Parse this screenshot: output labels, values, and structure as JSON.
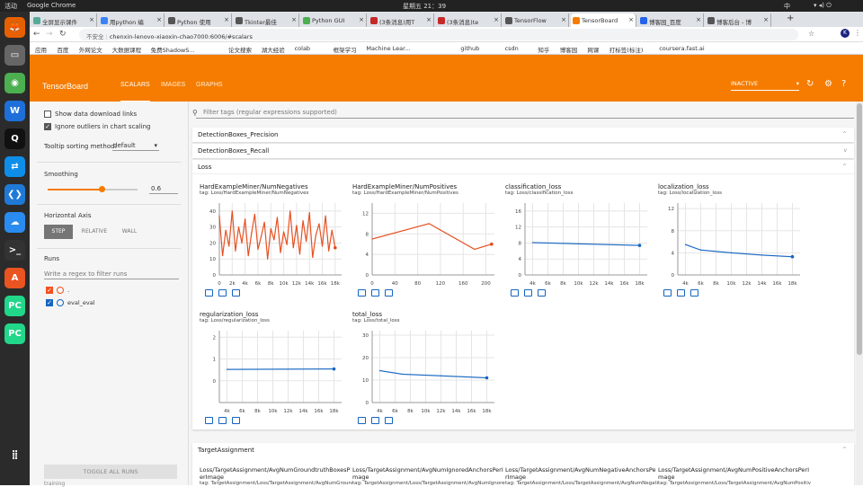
{
  "system": {
    "activities": "活动",
    "app_name": "Google Chrome",
    "clock": "星期五 21：39",
    "ime": "中"
  },
  "dock": [
    {
      "name": "firefox-icon",
      "color": "#e66000",
      "glyph": "🦊"
    },
    {
      "name": "files-icon",
      "color": "#666",
      "glyph": "▭"
    },
    {
      "name": "chrome-icon",
      "color": "#4caf50",
      "glyph": "◉"
    },
    {
      "name": "wps-icon",
      "color": "#1e6fd9",
      "glyph": "W"
    },
    {
      "name": "qq-icon",
      "color": "#111",
      "glyph": "Q"
    },
    {
      "name": "teamviewer-icon",
      "color": "#0e8ee9",
      "glyph": "⇄"
    },
    {
      "name": "vscode-icon",
      "color": "#1f7ad7",
      "glyph": "❮❯"
    },
    {
      "name": "baidu-netdisk-icon",
      "color": "#2a8cf0",
      "glyph": "☁"
    },
    {
      "name": "terminal-icon",
      "color": "#333",
      "glyph": ">_"
    },
    {
      "name": "software-center-icon",
      "color": "#e95420",
      "glyph": "A"
    },
    {
      "name": "pycharm-icon",
      "color": "#21d789",
      "glyph": "PC"
    },
    {
      "name": "pycharm-icon-2",
      "color": "#21d789",
      "glyph": "PC"
    },
    {
      "name": "show-apps-icon",
      "color": "#2b2b2b",
      "glyph": "⣿"
    }
  ],
  "tabs": [
    {
      "label": "全屏显示课件",
      "color": "#5a9"
    },
    {
      "label": "用python 编",
      "color": "#3b82f6"
    },
    {
      "label": "Python 使用",
      "color": "#555"
    },
    {
      "label": "Tkinter最佳",
      "color": "#555"
    },
    {
      "label": "Python GUI",
      "color": "#4caf50"
    },
    {
      "label": "(3条消息)用T",
      "color": "#c62828"
    },
    {
      "label": "(3条消息)te",
      "color": "#c62828"
    },
    {
      "label": "TensorFlow",
      "color": "#555"
    },
    {
      "label": "TensorBoard",
      "color": "#f57c00",
      "active": true
    },
    {
      "label": "博客园_百度",
      "color": "#2563eb"
    },
    {
      "label": "博客后台 - 博",
      "color": "#555"
    }
  ],
  "omnibox": {
    "security": "不安全",
    "url": "chenxin-lenovo-xiaoxin-chao7000:6006/#scalars"
  },
  "bookmarks": [
    "应用",
    "百度",
    "外网论文",
    "大数据课程",
    "免费ShadowS...",
    "论文搜索",
    "湖大经验",
    "colab",
    "框架学习",
    "Machine Lear...",
    "github",
    "csdn",
    "知乎",
    "博客园",
    "网课",
    "打标签(标注)",
    "coursera.fast.ai"
  ],
  "tensorboard": {
    "title": "TensorBoard",
    "nav": [
      "SCALARS",
      "IMAGES",
      "GRAPHS"
    ],
    "run_state": "INACTIVE"
  },
  "sidebar": {
    "show_download": "Show data download links",
    "ignore_outliers": "Ignore outliers in chart scaling",
    "tooltip_label": "Tooltip sorting method:",
    "tooltip_value": "default",
    "smoothing_label": "Smoothing",
    "smoothing_value": "0.6",
    "smoothing": 0.6,
    "haxis_label": "Horizontal Axis",
    "haxis_options": [
      "STEP",
      "RELATIVE",
      "WALL"
    ],
    "runs_label": "Runs",
    "runs_filter_placeholder": "Write a regex to filter runs",
    "run1": ".",
    "run2": "eval_eval",
    "toggle_all": "TOGGLE ALL RUNS",
    "footer": "training"
  },
  "main": {
    "filter_placeholder": "Filter tags (regular expressions supported)",
    "categories": [
      "DetectionBoxes_Precision",
      "DetectionBoxes_Recall",
      "Loss",
      "TargetAssignment"
    ]
  },
  "target_cards": [
    {
      "t": "Loss/TargetAssignment/AvgNumGroundtruthBoxesPerImage",
      "tag": "tag: TargetAssignment/Loss/TargetAssignment/AvgNumGroundtr"
    },
    {
      "t": "Loss/TargetAssignment/AvgNumIgnoredAnchorsPerImage",
      "tag": "tag: TargetAssignment/Loss/TargetAssignment/AvgNumIgnored"
    },
    {
      "t": "Loss/TargetAssignment/AvgNumNegativeAnchorsPerImage",
      "tag": "tag: TargetAssignment/Loss/TargetAssignment/AvgNumNegative"
    },
    {
      "t": "Loss/TargetAssignment/AvgNumPositiveAnchorsPerImage",
      "tag": "tag: TargetAssignment/Loss/TargetAssignment/AvgNumPositive"
    }
  ],
  "chart_data": [
    {
      "type": "line",
      "title": "HardExampleMiner/NumNegatives",
      "tag": "tag: Loss/HardExampleMiner/NumNegatives",
      "yticks": [
        "0",
        "10",
        "20",
        "30",
        "40"
      ],
      "xticks": [
        "0",
        "2k",
        "4k",
        "6k",
        "8k",
        "10k",
        "12k",
        "14k",
        "16k",
        "18k"
      ],
      "ylim": [
        0,
        45
      ],
      "xlim": [
        0,
        19000
      ],
      "series": [
        {
          "name": ".",
          "color": "#e64a19",
          "x": [
            0,
            500,
            1000,
            1500,
            2000,
            2500,
            3000,
            3500,
            4000,
            4500,
            5000,
            5500,
            6000,
            6500,
            7000,
            7500,
            8000,
            8500,
            9000,
            9500,
            10000,
            10500,
            11000,
            11500,
            12000,
            12500,
            13000,
            13500,
            14000,
            14500,
            15000,
            15500,
            16000,
            16500,
            17000,
            17500,
            18000
          ],
          "y": [
            37,
            12,
            28,
            18,
            40,
            15,
            30,
            20,
            35,
            12,
            26,
            38,
            16,
            24,
            33,
            10,
            29,
            22,
            36,
            14,
            27,
            19,
            40,
            17,
            31,
            13,
            34,
            21,
            39,
            11,
            25,
            32,
            18,
            37,
            15,
            28,
            17
          ]
        }
      ]
    },
    {
      "type": "line",
      "title": "HardExampleMiner/NumPositives",
      "tag": "tag: Loss/HardExampleMiner/NumPositives",
      "yticks": [
        "0",
        "4",
        "8",
        "12"
      ],
      "xticks": [
        "0",
        "40",
        "80",
        "120",
        "160",
        "200"
      ],
      "ylim": [
        0,
        14
      ],
      "xlim": [
        0,
        215
      ],
      "series": [
        {
          "name": ".",
          "color": "#e64a19",
          "x": [
            0,
            100,
            180,
            210
          ],
          "y": [
            7,
            10,
            5,
            6
          ]
        }
      ]
    },
    {
      "type": "line",
      "title": "classification_loss",
      "tag": "tag: Loss/classification_loss",
      "yticks": [
        "0",
        "4",
        "8",
        "12",
        "16"
      ],
      "xticks": [
        "4k",
        "6k",
        "8k",
        "10k",
        "12k",
        "14k",
        "16k",
        "18k"
      ],
      "ylim": [
        0,
        18
      ],
      "xlim": [
        3000,
        19000
      ],
      "series": [
        {
          "name": "eval_eval",
          "color": "#1565c0",
          "x": [
            4000,
            10000,
            18000
          ],
          "y": [
            8.1,
            7.8,
            7.4
          ]
        }
      ]
    },
    {
      "type": "line",
      "title": "localization_loss",
      "tag": "tag: Loss/localization_loss",
      "yticks": [
        "0",
        "4",
        "8",
        "12"
      ],
      "xticks": [
        "4k",
        "6k",
        "8k",
        "10k",
        "12k",
        "14k",
        "16k",
        "18k"
      ],
      "ylim": [
        0,
        13
      ],
      "xlim": [
        3000,
        19000
      ],
      "series": [
        {
          "name": "eval_eval",
          "color": "#1565c0",
          "x": [
            4000,
            6000,
            10000,
            14000,
            18000
          ],
          "y": [
            5.5,
            4.5,
            4.0,
            3.6,
            3.3
          ]
        }
      ]
    },
    {
      "type": "line",
      "title": "regularization_loss",
      "tag": "tag: Loss/regularization_loss",
      "yticks": [
        "0",
        "1",
        "2"
      ],
      "xticks": [
        "4k",
        "6k",
        "8k",
        "10k",
        "12k",
        "14k",
        "16k",
        "18k"
      ],
      "ylim": [
        -1,
        2.3
      ],
      "xlim": [
        3000,
        19000
      ],
      "series": [
        {
          "name": "eval_eval",
          "color": "#1565c0",
          "x": [
            4000,
            18000
          ],
          "y": [
            0.52,
            0.54
          ]
        }
      ]
    },
    {
      "type": "line",
      "title": "total_loss",
      "tag": "tag: Loss/total_loss",
      "yticks": [
        "0",
        "10",
        "20",
        "30"
      ],
      "xticks": [
        "4k",
        "6k",
        "8k",
        "10k",
        "12k",
        "14k",
        "16k",
        "18k"
      ],
      "ylim": [
        0,
        32
      ],
      "xlim": [
        3000,
        19000
      ],
      "series": [
        {
          "name": "eval_eval",
          "color": "#1565c0",
          "x": [
            4000,
            7000,
            12000,
            18000
          ],
          "y": [
            14.2,
            12.6,
            11.9,
            11.0
          ]
        }
      ]
    }
  ]
}
